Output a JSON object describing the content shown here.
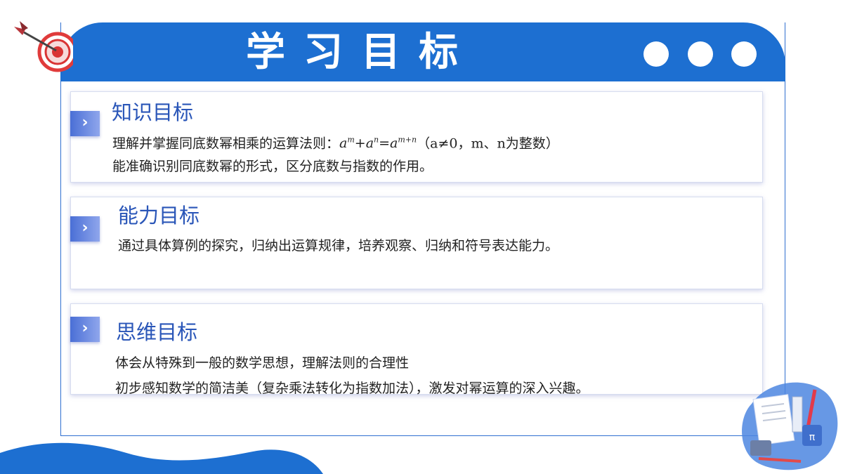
{
  "header": {
    "title": "学习目标"
  },
  "sections": [
    {
      "title": "知识目标",
      "lines": [
        "理解并掌握同底数幂相乘的运算法则：",
        "（a≠0，m、n为整数）",
        "能准确识别同底数幂的形式，区分底数与指数的作用。"
      ],
      "formula": {
        "base": "a",
        "exp1": "m",
        "exp2": "n",
        "result_exp": "m+n"
      }
    },
    {
      "title": "能力目标",
      "lines": [
        "通过具体算例的探究，归纳出运算规律，培养观察、归纳和符号表达能力。"
      ]
    },
    {
      "title": "思维目标",
      "lines": [
        "体会从特殊到一般的数学思想，理解法则的合理性",
        "初步感知数学的简洁美（复杂乘法转化为指数加法），激发对幂运算的深入兴趣。"
      ]
    }
  ],
  "icons": {
    "chevron": "›",
    "pi": "π"
  },
  "colors": {
    "brand": "#1d6fd1",
    "title": "#2a56b8",
    "chevron": "#4a6fd6"
  }
}
